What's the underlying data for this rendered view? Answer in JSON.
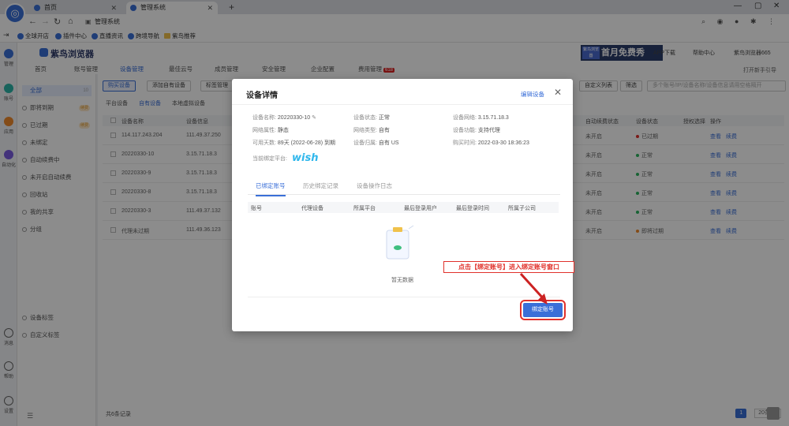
{
  "browser": {
    "tabs": [
      {
        "label": "首页"
      },
      {
        "label": "管理系统"
      }
    ],
    "url": "管理系统",
    "bookmarks": [
      "全球开店",
      "插件中心",
      "直播资讯",
      "跨境导航",
      "紫鸟推荐"
    ]
  },
  "rail": {
    "items": [
      "管理",
      "账号",
      "应用",
      "自动化",
      "消息",
      "帮助",
      "设置"
    ]
  },
  "app": {
    "logo": "紫鸟浏览器",
    "topnav": [
      "首页",
      "账号管理",
      "设备管理",
      "最佳云号",
      "成员管理",
      "安全管理",
      "企业配置",
      "费用管理"
    ],
    "topnav_badge": "618",
    "banner": {
      "small": "紫鸟浏览器",
      "text": "首月免费秀"
    },
    "header_links": [
      "APP下载",
      "帮助中心",
      "紫鸟浏览器665"
    ],
    "open_new_tab": "打开新手引导",
    "sidebar": {
      "items": [
        {
          "label": "全部",
          "count": "10"
        },
        {
          "label": "即将到期",
          "badge": "续费"
        },
        {
          "label": "已过期",
          "badge": "续费"
        },
        {
          "label": "未绑定"
        },
        {
          "label": "自动续费中"
        },
        {
          "label": "未开启自动续费"
        },
        {
          "label": "回收站"
        },
        {
          "label": "我的共享"
        },
        {
          "label": "分组"
        },
        {
          "label": "设备标签"
        },
        {
          "label": "自定义标签"
        }
      ]
    }
  },
  "main": {
    "toolbar": [
      "购买设备",
      "添加自有设备",
      "标签管理",
      "自定义列表",
      "筛选"
    ],
    "search_placeholder": "多个账号/IP/设备名称/设备信息请用空格隔开",
    "subtabs": [
      "平台设备",
      "自有设备",
      "本地虚拟设备"
    ],
    "columns": [
      "设备名称",
      "设备信息",
      "自动续费状态",
      "设备状态",
      "授权选择",
      "操作"
    ],
    "rows": [
      {
        "name": "114.117.243.204",
        "info": "111.49.37.250",
        "renew": "未开启",
        "status": "已过期"
      },
      {
        "name": "20220330-10",
        "info": "3.15.71.18.3",
        "renew": "未开启",
        "status": "正常"
      },
      {
        "name": "20220330-9",
        "info": "3.15.71.18.3",
        "renew": "未开启",
        "status": "正常"
      },
      {
        "name": "20220330-8",
        "info": "3.15.71.18.3",
        "renew": "未开启",
        "status": "正常"
      },
      {
        "name": "20220330-3",
        "info": "111.49.37.132",
        "renew": "未开启",
        "status": "正常"
      },
      {
        "name": "代理未过期",
        "info": "111.49.36.123",
        "renew": "未开启",
        "status": "即将过期"
      }
    ],
    "row_actions": [
      "查看",
      "续费"
    ],
    "total": "共6条记录",
    "page": "1",
    "page_size": "20条/页"
  },
  "modal": {
    "title": "设备详情",
    "edit_link": "编辑设备",
    "fields": {
      "name_label": "设备名称:",
      "name_value": "20220330-10",
      "status_label": "设备状态:",
      "status_value": "正常",
      "network_label": "设备网络:",
      "network_value": "3.15.71.18.3",
      "attr_label": "网络属性:",
      "attr_value": "静态",
      "type_label": "网络类型:",
      "type_value": "自有",
      "func_label": "设备功能:",
      "func_value": "支持代理",
      "days_label": "可用天数:",
      "days_value": "89天 (2022-06-28) 到期",
      "region_label": "设备归属:",
      "region_value": "自有 US",
      "buy_label": "购买时间:",
      "buy_value": "2022-03-30 18:36:23",
      "platform_label": "当前绑定平台:",
      "platform_value": "wish"
    },
    "tabs": [
      "已绑定账号",
      "历史绑定记录",
      "设备操作日志"
    ],
    "table_columns": [
      "账号",
      "代理设备",
      "所属平台",
      "最后登录用户",
      "最后登录时间",
      "所属子公司"
    ],
    "empty_text": "暂无数据",
    "bind_button": "绑定账号",
    "callout": "点击【绑定账号】进入绑定账号窗口"
  },
  "colors": {
    "accent": "#3a6fd8",
    "callout_red": "#e0312b",
    "wish_blue": "#2fb7ec"
  }
}
